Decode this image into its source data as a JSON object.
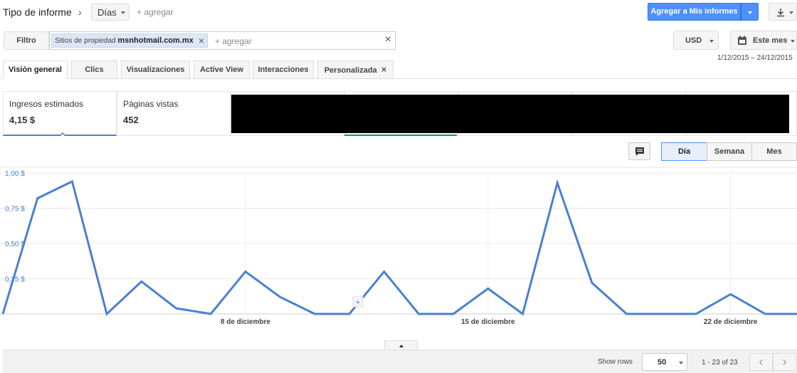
{
  "header": {
    "report_type_label": "Tipo de informe",
    "dimension_value": "Días",
    "add_label": "+ agregar",
    "add_to_reports_label": "Agregar a Mis informes",
    "download_icon": "download-icon"
  },
  "filter": {
    "button_label": "Filtro",
    "chip_prefix": "Sitios de propiedad",
    "chip_value": "msnhotmail.com.mx",
    "add_label": "+ agregar"
  },
  "currency": {
    "value": "USD"
  },
  "period": {
    "label": "Este mes",
    "range": "1/12/2015 – 24/12/2015"
  },
  "tabs": [
    {
      "label": "Visión general",
      "active": true
    },
    {
      "label": "Clics"
    },
    {
      "label": "Visualizaciones"
    },
    {
      "label": "Active View"
    },
    {
      "label": "Interacciones"
    },
    {
      "label": "Personalizada",
      "closable": true
    }
  ],
  "metrics": [
    {
      "label": "Ingresos estimados",
      "value": "4,15 $",
      "selected": true
    },
    {
      "label": "Páginas vistas",
      "value": "452"
    }
  ],
  "granularity": {
    "options": [
      "Día",
      "Semana",
      "Mes"
    ],
    "selected": "Día"
  },
  "chart_data": {
    "type": "line",
    "series": [
      {
        "name": "Ingresos estimados",
        "color": "#4a80d0",
        "x": [
          "1 dic",
          "2 dic",
          "3 dic",
          "4 dic",
          "5 dic",
          "6 dic",
          "7 dic",
          "8 dic",
          "9 dic",
          "10 dic",
          "11 dic",
          "12 dic",
          "13 dic",
          "14 dic",
          "15 dic",
          "16 dic",
          "17 dic",
          "18 dic",
          "19 dic",
          "20 dic",
          "21 dic",
          "22 dic",
          "23 dic",
          "24 dic"
        ],
        "values": [
          0.0,
          0.82,
          0.94,
          0.0,
          0.23,
          0.04,
          0.0,
          0.3,
          0.12,
          0.0,
          0.0,
          0.3,
          0.0,
          0.0,
          0.18,
          0.0,
          0.93,
          0.22,
          0.0,
          0.0,
          0.0,
          0.14,
          0.0,
          0.0
        ]
      }
    ],
    "y_tick_labels": [
      "1,00 $",
      "0,75 $",
      "0,50 $",
      "0,25 $"
    ],
    "y_ticks": [
      1.0,
      0.75,
      0.5,
      0.25
    ],
    "x_tick_labels": [
      "8 de diciembre",
      "15 de diciembre",
      "22 de diciembre"
    ],
    "x_tick_days": [
      8,
      15,
      22
    ],
    "ylim": [
      0,
      1.0
    ],
    "grid": true
  },
  "footer": {
    "show_rows_label": "Show rows",
    "rows_value": "50",
    "range_text": "1 - 23 of 23"
  }
}
